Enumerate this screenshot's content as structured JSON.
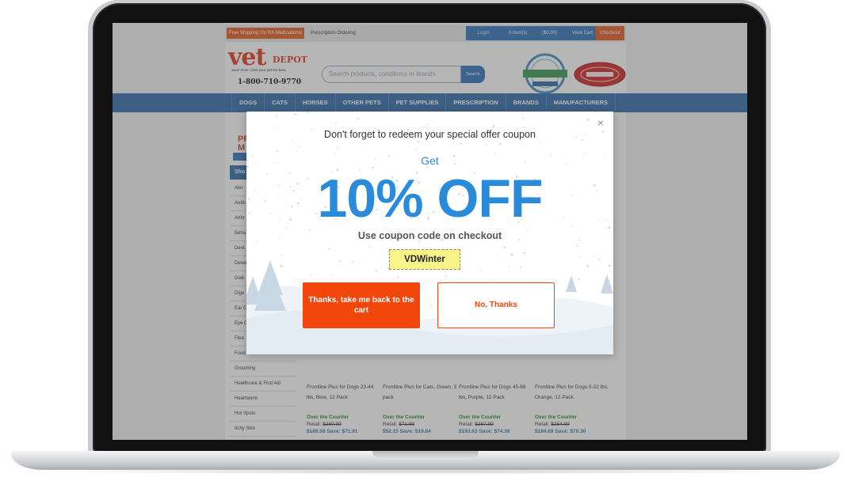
{
  "topbar": {
    "promo": "Free Shipping On RX Medications!",
    "rx_ordering": "Prescription Ordering",
    "login": "Login",
    "items": "0 item(s)",
    "amount": "($0.00)",
    "view_cart": "View Cart",
    "checkout": "Checkout"
  },
  "header": {
    "logo_main": "vet",
    "logo_sub": "DEPOT",
    "tagline": "Save more. Give your pet the best.",
    "phone": "1-800-710-9770",
    "search_placeholder": "Search products, conditions or brands",
    "search_button": "Search"
  },
  "nav": [
    "DOGS",
    "CATS",
    "HORSES",
    "OTHER PETS",
    "PET SUPPLIES",
    "PRESCRIPTION",
    "BRANDS",
    "MANUFACTURERS"
  ],
  "sidebar": {
    "promo": "PR\nM",
    "heading": "Sho",
    "items": [
      "Aler",
      "Antib",
      "Arthr",
      "Beha",
      "Dent",
      "Dewo",
      "Diab",
      "Dige",
      "Ear C",
      "Eye C",
      "Flea",
      "Food",
      "Grooming",
      "Healthcare & First Aid",
      "Heartworm",
      "Hot Spots",
      "Itchy Skin"
    ]
  },
  "products": [
    {
      "name": "Frontline Plus for Dogs 23-44 lbs, Blue, 12 Pack",
      "badge": "Over the Counter",
      "retail_label": "Retail:",
      "retail": "$260.99",
      "price": "$189.08",
      "save": "Save: $71.91"
    },
    {
      "name": "Frontline Plus for Cats, Green, 3 pack",
      "badge": "Over the Counter",
      "retail_label": "Retail:",
      "retail": "$71.99",
      "price": "$52.15",
      "save": "Save: $19.84"
    },
    {
      "name": "Frontline Plus for Dogs 45-88 lbs, Purple, 12 Pack",
      "badge": "Over the Counter",
      "retail_label": "Retail:",
      "retail": "$267.99",
      "price": "$193.63",
      "save": "Save: $74.36"
    },
    {
      "name": "Frontline Plus for Dogs 0-22 lbs, Orange, 12 Pack",
      "badge": "Over the Counter",
      "retail_label": "Retail:",
      "retail": "$254.99",
      "price": "$184.69",
      "save": "Save: $70.30"
    }
  ],
  "modal": {
    "close": "×",
    "headline": "Don't forget to redeem your special offer coupon",
    "get": "Get",
    "offer": "10% OFF",
    "instruction": "Use coupon code on checkout",
    "code": "VDWinter",
    "accept": "Thanks, take me back to the cart",
    "decline": "No, Thanks"
  },
  "colors": {
    "brand_orange": "#f2460a",
    "brand_blue": "#2d6aa8",
    "offer_blue": "#2b8bdb",
    "coupon_yellow": "#f7f58a"
  }
}
